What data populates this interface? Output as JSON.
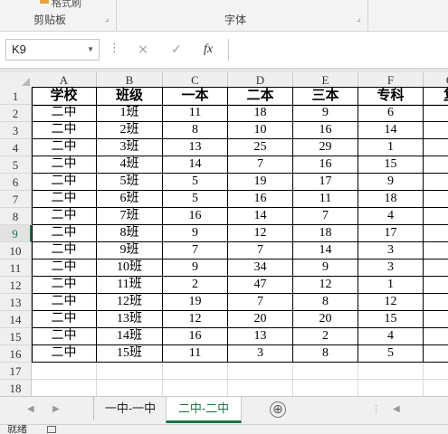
{
  "ribbon": {
    "clipboard_label": "剪贴板",
    "font_label": "字体",
    "paste_partial": "格式刷",
    "launcher_icon": "dialog-launcher-icon"
  },
  "formula_bar": {
    "name_box_value": "K9",
    "cancel_icon": "×",
    "enter_icon": "✓",
    "fx_label": "fx",
    "formula_value": ""
  },
  "columns": [
    "A",
    "B",
    "C",
    "D",
    "E",
    "F",
    "G"
  ],
  "rows": [
    "1",
    "2",
    "3",
    "4",
    "5",
    "6",
    "7",
    "8",
    "9",
    "10",
    "11",
    "12",
    "13",
    "14",
    "15",
    "16",
    "17",
    "18"
  ],
  "active_row": "9",
  "table": {
    "headers": [
      "学校",
      "班级",
      "一本",
      "二本",
      "三本",
      "专科",
      "复"
    ],
    "data": [
      [
        "二中",
        "1班",
        "11",
        "18",
        "9",
        "6"
      ],
      [
        "二中",
        "2班",
        "8",
        "10",
        "16",
        "14"
      ],
      [
        "二中",
        "3班",
        "13",
        "25",
        "29",
        "1"
      ],
      [
        "二中",
        "4班",
        "14",
        "7",
        "16",
        "15"
      ],
      [
        "二中",
        "5班",
        "5",
        "19",
        "17",
        "9"
      ],
      [
        "二中",
        "6班",
        "5",
        "16",
        "11",
        "18"
      ],
      [
        "二中",
        "7班",
        "16",
        "14",
        "7",
        "4"
      ],
      [
        "二中",
        "8班",
        "9",
        "12",
        "18",
        "17"
      ],
      [
        "二中",
        "9班",
        "7",
        "7",
        "14",
        "3"
      ],
      [
        "二中",
        "10班",
        "9",
        "34",
        "9",
        "3"
      ],
      [
        "二中",
        "11班",
        "2",
        "47",
        "12",
        "1"
      ],
      [
        "二中",
        "12班",
        "19",
        "7",
        "8",
        "12"
      ],
      [
        "二中",
        "13班",
        "12",
        "20",
        "20",
        "15"
      ],
      [
        "二中",
        "14班",
        "16",
        "13",
        "2",
        "4"
      ],
      [
        "二中",
        "15班",
        "11",
        "3",
        "8",
        "5"
      ]
    ]
  },
  "sheet_tabs": {
    "tabs": [
      "一中-一中",
      "二中-二中"
    ],
    "active_index": 1,
    "add_icon": "⊕"
  },
  "status_bar": {
    "ready": "就绪"
  },
  "colors": {
    "accent": "#217346",
    "grid_line": "#dadada",
    "header_bg": "#efefef"
  }
}
